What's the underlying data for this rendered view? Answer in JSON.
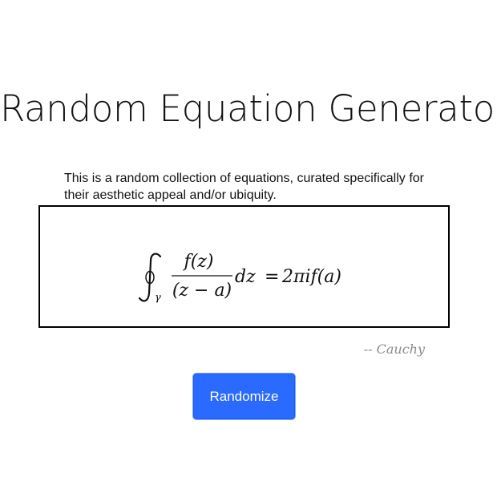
{
  "page": {
    "title": "Random Equation Generator",
    "description": "This is a random collection of equations, curated specifically for their aesthetic appeal and/or ubiquity."
  },
  "equation": {
    "numerator": "f(z)",
    "denominator": "(z − a)",
    "contour_subscript": "γ",
    "differential": "dz",
    "equals": "=",
    "rhs": "2πif(a)",
    "attribution": "-- Cauchy"
  },
  "controls": {
    "randomize_label": "Randomize"
  },
  "colors": {
    "button": "#2a6aff",
    "attribution": "#8a8a8a"
  }
}
